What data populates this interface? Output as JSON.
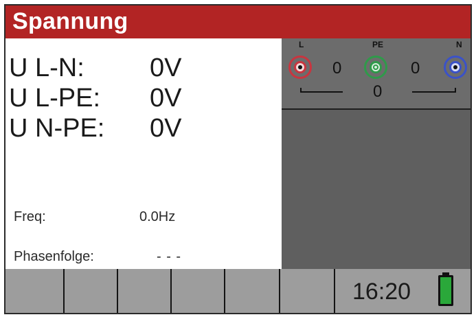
{
  "title": "Spannung",
  "measurements": [
    {
      "label": "U L-N:",
      "value": "0V"
    },
    {
      "label": "U L-PE:",
      "value": "0V"
    },
    {
      "label": "U N-PE:",
      "value": "0V"
    }
  ],
  "frequency": {
    "label": "Freq:",
    "value": "0.0Hz"
  },
  "phase_sequence": {
    "label": "Phasenfolge:",
    "value": "- - -"
  },
  "terminals": {
    "labels": {
      "l": "L",
      "pe": "PE",
      "n": "N"
    },
    "values": {
      "l_pe": "0",
      "pe_n": "0",
      "l_n": "0"
    },
    "colors": {
      "l": "#c9353f",
      "pe": "#2f9a4a",
      "n": "#3b52c8"
    }
  },
  "status": {
    "time": "16:20",
    "battery_icon": "battery-full-icon"
  },
  "colors": {
    "title_bar": "#b22424",
    "battery_fill": "#2aa83a"
  }
}
